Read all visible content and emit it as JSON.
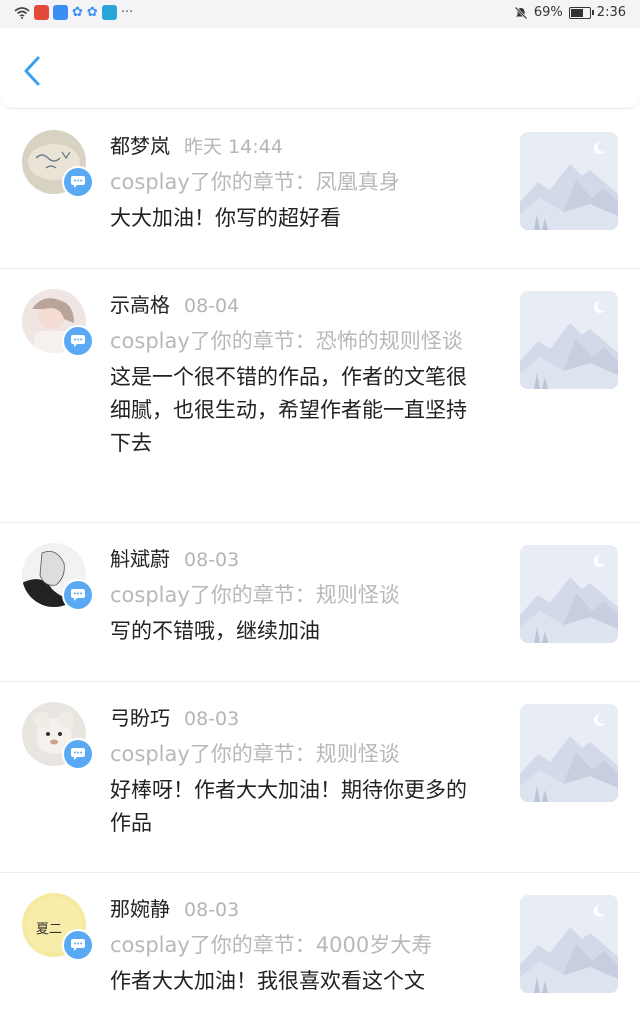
{
  "status_bar": {
    "battery": "69%",
    "battery_level": 0.69,
    "time": "2:36",
    "overflow": "···"
  },
  "header": {
    "back_icon": "chevron-left-icon"
  },
  "colors": {
    "accent": "#3aa0f0",
    "badge": "#5aa9f5",
    "muted_text": "#b8b8b8",
    "primary_text": "#222222"
  },
  "comments": [
    {
      "name": "都梦岚",
      "time": "昨天 14:44",
      "chapter": "cosplay了你的章节：凤凰真身",
      "comment": "大大加油！你写的超好看"
    },
    {
      "name": "示高格",
      "time": "08-04",
      "chapter": "cosplay了你的章节：恐怖的规则怪谈",
      "comment": "这是一个很不错的作品，作者的文笔很细腻，也很生动，希望作者能一直坚持下去"
    },
    {
      "name": "斛斌蔚",
      "time": "08-03",
      "chapter": "cosplay了你的章节：规则怪谈",
      "comment": "写的不错哦，继续加油"
    },
    {
      "name": "弓盼巧",
      "time": "08-03",
      "chapter": "cosplay了你的章节：规则怪谈",
      "comment": "好棒呀！作者大大加油！期待你更多的作品"
    },
    {
      "name": "那婉静",
      "time": "08-03",
      "chapter": "cosplay了你的章节：4000岁大寿",
      "comment": "作者大大加油！我很喜欢看这个文"
    }
  ]
}
